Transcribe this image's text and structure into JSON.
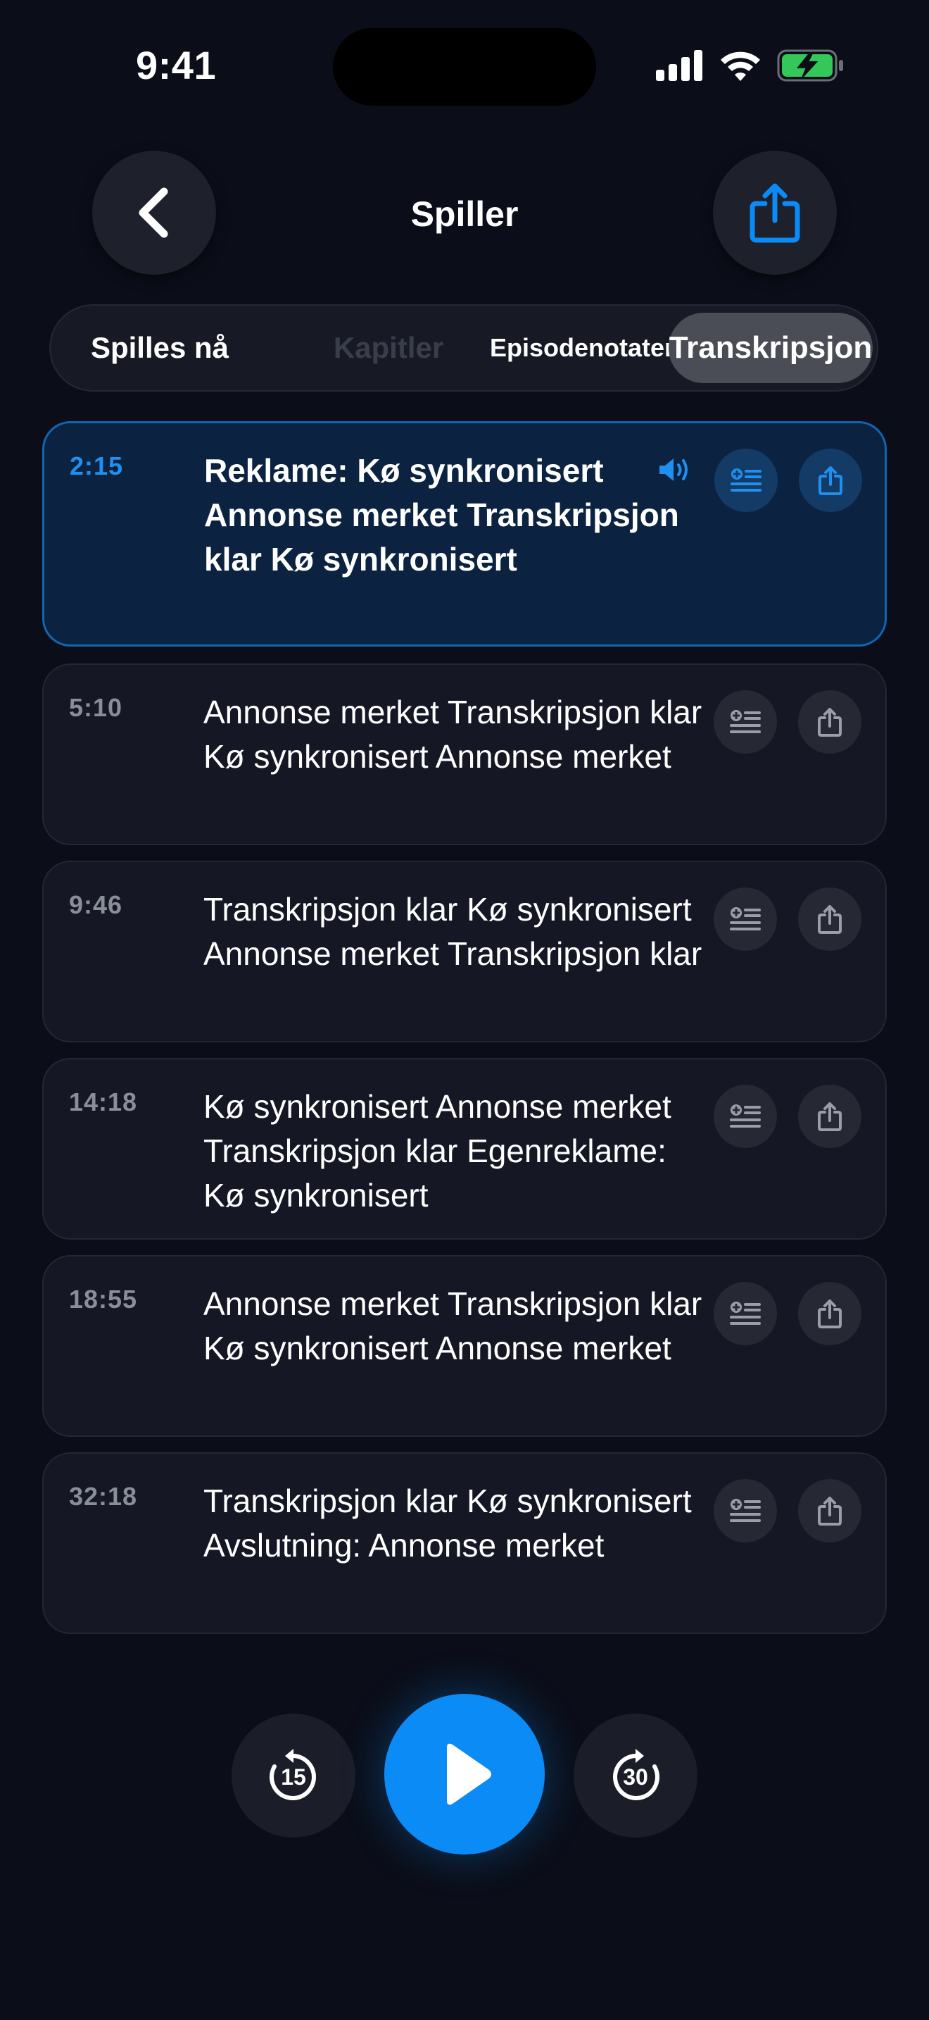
{
  "status_bar": {
    "time": "9:41",
    "icons": [
      "cellular-signal-icon",
      "wifi-icon",
      "battery-charging-icon"
    ]
  },
  "header": {
    "title": "Spiller",
    "back_icon": "chevron-left-icon",
    "share_icon": "share-icon"
  },
  "tabs": [
    {
      "label": "Spilles nå",
      "state": "normal"
    },
    {
      "label": "Kapitler",
      "state": "disabled"
    },
    {
      "label": "Episodenotater",
      "state": "normal"
    },
    {
      "label": "Transkripsjon",
      "state": "selected"
    }
  ],
  "transcript": [
    {
      "time": "2:15",
      "text": "Reklame: Kø synkronisert Annonse merket Transkripsjon klar Kø synkronisert",
      "active": true
    },
    {
      "time": "5:10",
      "text": "Annonse merket Transkripsjon klar Kø synkronisert Annonse merket",
      "active": false
    },
    {
      "time": "9:46",
      "text": "Transkripsjon klar Kø synkronisert Annonse merket Transkripsjon klar",
      "active": false
    },
    {
      "time": "14:18",
      "text": "Kø synkronisert Annonse merket Transkripsjon klar Egenreklame: Kø synkronisert",
      "active": false
    },
    {
      "time": "18:55",
      "text": "Annonse merket Transkripsjon klar Kø synkronisert Annonse merket",
      "active": false
    },
    {
      "time": "32:18",
      "text": "Transkripsjon klar Kø synkronisert Avslutning: Annonse merket",
      "active": false
    }
  ],
  "controls": {
    "skip_back_seconds": "15",
    "skip_forward_seconds": "30",
    "play_icon": "play-icon"
  },
  "colors": {
    "background": "#0b0e19",
    "accent": "#0a8bf5",
    "active_card": "#0b2341",
    "card": "#151824"
  }
}
